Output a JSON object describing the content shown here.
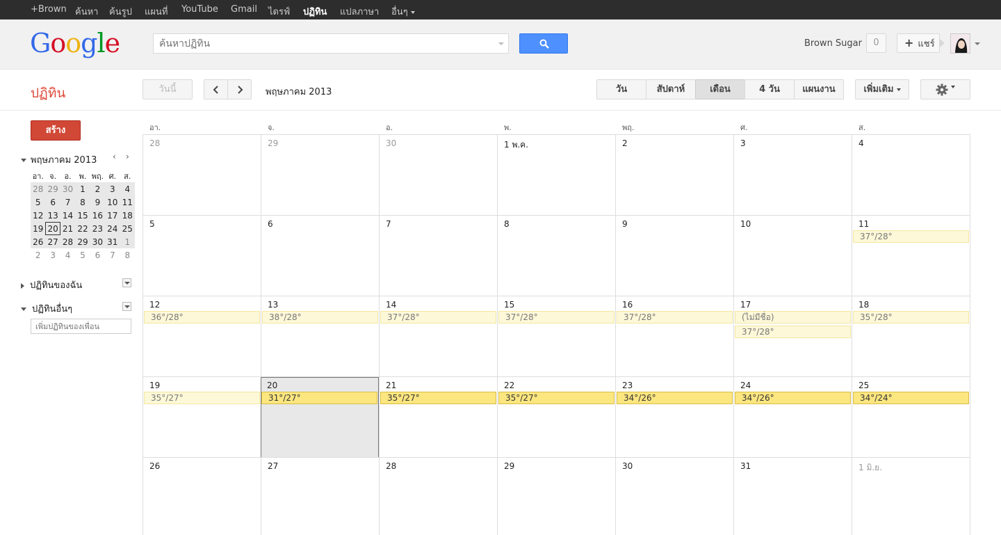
{
  "topnav": {
    "items": [
      "+Brown",
      "ค้นหา",
      "ค้นรูป",
      "แผนที่",
      "YouTube",
      "Gmail",
      "ไดรฟ์",
      "ปฏิทิน",
      "แปลภาษา",
      "อื่นๆ"
    ]
  },
  "header": {
    "logo": "Google",
    "search_placeholder": "ค้นหาปฏิทิน",
    "user_name": "Brown Sugar",
    "notifications": "0",
    "share_label": "แชร์"
  },
  "toolbar": {
    "app_title": "ปฏิทิน",
    "today": "วันนี้",
    "prev": "‹",
    "next": "›",
    "date_range": "พฤษภาคม 2013",
    "views": {
      "day": "วัน",
      "week": "สัปดาห์",
      "month": "เดือน",
      "fourday": "4 วัน",
      "agenda": "แผนงาน"
    },
    "more": "เพิ่มเติม"
  },
  "sidebar": {
    "create": "สร้าง",
    "mini_title": "พฤษภาคม 2013",
    "mini_prev": "‹",
    "mini_next": "›",
    "mini_headers": [
      "อา.",
      "จ.",
      "อ.",
      "พ.",
      "พฤ.",
      "ศ.",
      "ส."
    ],
    "mini_weeks": [
      [
        "28",
        "29",
        "30",
        "1",
        "2",
        "3",
        "4"
      ],
      [
        "5",
        "6",
        "7",
        "8",
        "9",
        "10",
        "11"
      ],
      [
        "12",
        "13",
        "14",
        "15",
        "16",
        "17",
        "18"
      ],
      [
        "19",
        "20",
        "21",
        "22",
        "23",
        "24",
        "25"
      ],
      [
        "26",
        "27",
        "28",
        "29",
        "30",
        "31",
        "1"
      ],
      [
        "2",
        "3",
        "4",
        "5",
        "6",
        "7",
        "8"
      ]
    ],
    "my_calendars": "ปฏิทินของฉัน",
    "other_calendars": "ปฏิทินอื่นๆ",
    "add_friend_placeholder": "เพิ่มปฏิทินของเพื่อน"
  },
  "grid": {
    "dow": [
      "อา.",
      "จ.",
      "อ.",
      "พ.",
      "พฤ.",
      "ศ.",
      "ส."
    ],
    "weeks": [
      [
        "28",
        "29",
        "30",
        "1 พ.ค.",
        "2",
        "3",
        "4"
      ],
      [
        "5",
        "6",
        "7",
        "8",
        "9",
        "10",
        "11"
      ],
      [
        "12",
        "13",
        "14",
        "15",
        "16",
        "17",
        "18"
      ],
      [
        "19",
        "20",
        "21",
        "22",
        "23",
        "24",
        "25"
      ],
      [
        "26",
        "27",
        "28",
        "29",
        "30",
        "31",
        "1 มิ.ย."
      ]
    ],
    "events": {
      "w1d6": "37°/28°",
      "w2d0": "36°/28°",
      "w2d1": "38°/28°",
      "w2d2": "37°/28°",
      "w2d3": "37°/28°",
      "w2d4": "37°/28°",
      "w2d5a": "(ไม่มีชื่อ)",
      "w2d5b": "37°/28°",
      "w2d6": "35°/28°",
      "w3d0": "35°/27°",
      "w3d1": "31°/27°",
      "w3d2": "35°/27°",
      "w3d3": "35°/27°",
      "w3d4": "34°/26°",
      "w3d5": "34°/26°",
      "w3d6": "34°/24°"
    }
  }
}
